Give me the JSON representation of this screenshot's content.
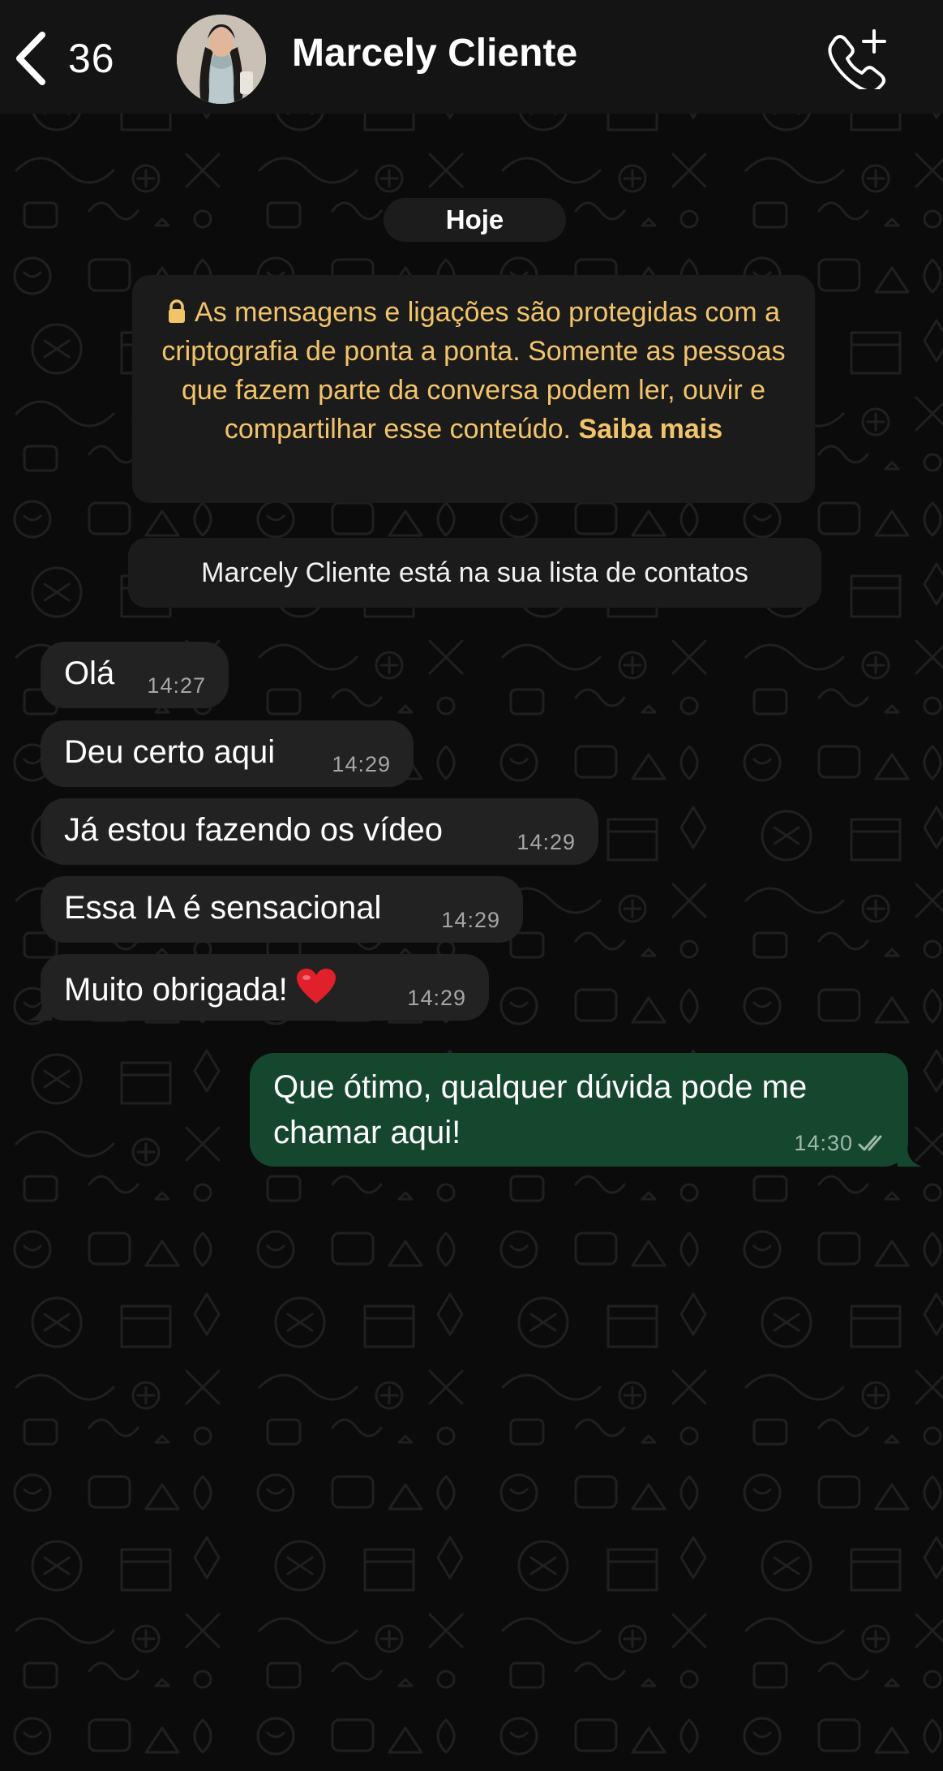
{
  "header": {
    "back_count": "36",
    "contact_name": "Marcely Cliente"
  },
  "chat": {
    "date_label": "Hoje",
    "encryption_notice": "As mensagens e ligações são protegidas com a criptografia de ponta a ponta. Somente as pessoas que fazem parte da conversa podem ler, ouvir e compartilhar esse conteúdo.",
    "encryption_link": "Saiba mais",
    "contact_notice": "Marcely Cliente está na sua lista de contatos",
    "messages": [
      {
        "direction": "incoming",
        "text": "Olá",
        "time": "14:27"
      },
      {
        "direction": "incoming",
        "text": "Deu certo aqui",
        "time": "14:29"
      },
      {
        "direction": "incoming",
        "text": "Já estou fazendo os vídeo",
        "time": "14:29"
      },
      {
        "direction": "incoming",
        "text": "Essa IA é sensacional",
        "time": "14:29"
      },
      {
        "direction": "incoming",
        "text": "Muito obrigada!",
        "emoji": "heart-emoji",
        "time": "14:29"
      },
      {
        "direction": "outgoing",
        "text": "Que ótimo, qualquer dúvida pode me chamar aqui!",
        "time": "14:30",
        "status": "read-double-check"
      }
    ]
  },
  "colors": {
    "background": "#0b0b0b",
    "header": "#141414",
    "incoming_bubble": "#222222",
    "outgoing_bubble": "#15472f",
    "encryption_text": "#f2c46a"
  }
}
